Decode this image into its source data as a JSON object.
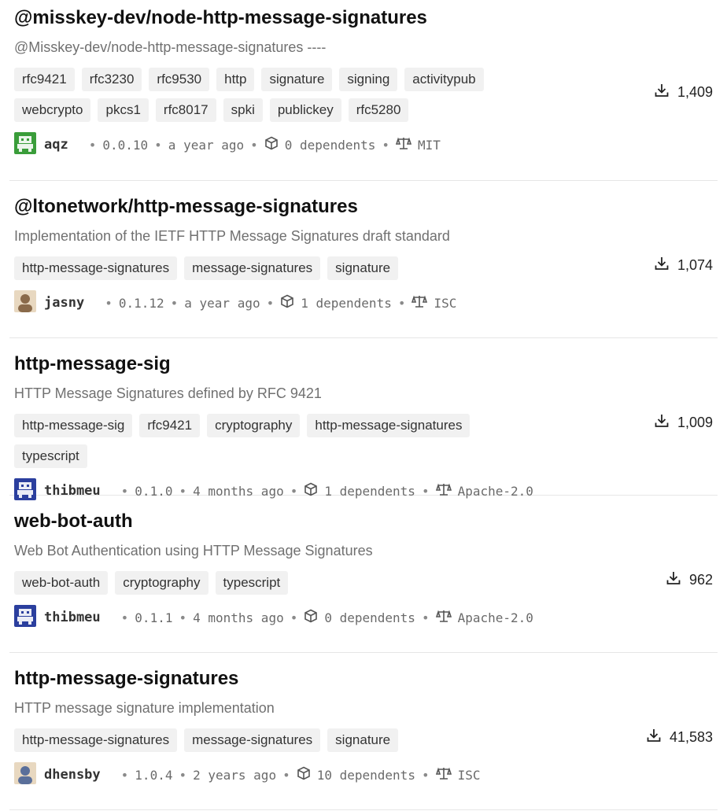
{
  "packages": [
    {
      "name": "@misskey-dev/node-http-message-signatures",
      "description": "@Misskey-dev/node-http-message-signatures ----",
      "keywords": [
        "rfc9421",
        "rfc3230",
        "rfc9530",
        "http",
        "signature",
        "signing",
        "activitypub",
        "webcrypto",
        "pkcs1",
        "rfc8017",
        "spki",
        "publickey",
        "rfc5280"
      ],
      "publisher": "aqz",
      "version": "0.0.10",
      "published": "a year ago",
      "dependents": "0 dependents",
      "license": "MIT",
      "downloads": "1,409",
      "avatar_color": "#3a9d3a"
    },
    {
      "name": "@ltonetwork/http-message-signatures",
      "description": "Implementation of the IETF HTTP Message Signatures draft standard",
      "keywords": [
        "http-message-signatures",
        "message-signatures",
        "signature"
      ],
      "publisher": "jasny",
      "version": "0.1.12",
      "published": "a year ago",
      "dependents": "1 dependents",
      "license": "ISC",
      "downloads": "1,074",
      "avatar_color": "#8a6a4a"
    },
    {
      "name": "http-message-sig",
      "description": "HTTP Message Signatures defined by RFC 9421",
      "keywords": [
        "http-message-sig",
        "rfc9421",
        "cryptography",
        "http-message-signatures",
        "typescript"
      ],
      "publisher": "thibmeu",
      "version": "0.1.0",
      "published": "4 months ago",
      "dependents": "1 dependents",
      "license": "Apache-2.0",
      "downloads": "1,009",
      "avatar_color": "#2b3f9e"
    },
    {
      "name": "web-bot-auth",
      "description": "Web Bot Authentication using HTTP Message Signatures",
      "keywords": [
        "web-bot-auth",
        "cryptography",
        "typescript"
      ],
      "publisher": "thibmeu",
      "version": "0.1.1",
      "published": "4 months ago",
      "dependents": "0 dependents",
      "license": "Apache-2.0",
      "downloads": "962",
      "avatar_color": "#2b3f9e"
    },
    {
      "name": "http-message-signatures",
      "description": "HTTP message signature implementation",
      "keywords": [
        "http-message-signatures",
        "message-signatures",
        "signature"
      ],
      "publisher": "dhensby",
      "version": "1.0.4",
      "published": "2 years ago",
      "dependents": "10 dependents",
      "license": "ISC",
      "downloads": "41,583",
      "avatar_color": "#5a6f9a"
    }
  ],
  "separator": "•"
}
